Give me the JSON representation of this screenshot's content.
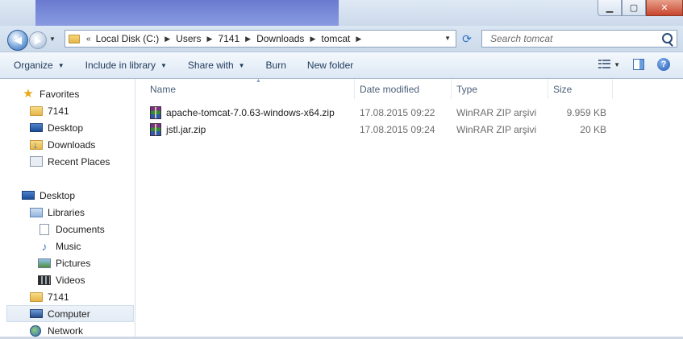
{
  "window": {
    "caption_buttons": [
      "minimize",
      "maximize",
      "close"
    ]
  },
  "address": {
    "prefix": "«",
    "crumbs": [
      "Local Disk (C:)",
      "Users",
      "7141",
      "Downloads",
      "tomcat"
    ],
    "search_placeholder": "Search tomcat"
  },
  "toolbar": {
    "organize": "Organize",
    "include_in_library": "Include in library",
    "share_with": "Share with",
    "burn": "Burn",
    "new_folder": "New folder"
  },
  "nav": {
    "items": [
      {
        "label": "Favorites",
        "icon": "star-icon"
      },
      {
        "label": "7141",
        "icon": "folder-icon"
      },
      {
        "label": "Desktop",
        "icon": "desktop-icon"
      },
      {
        "label": "Downloads",
        "icon": "downloads-icon"
      },
      {
        "label": "Recent Places",
        "icon": "recent-places-icon"
      },
      {
        "label": "Desktop",
        "icon": "desktop-icon"
      },
      {
        "label": "Libraries",
        "icon": "libraries-icon"
      },
      {
        "label": "Documents",
        "icon": "documents-icon"
      },
      {
        "label": "Music",
        "icon": "music-icon"
      },
      {
        "label": "Pictures",
        "icon": "pictures-icon"
      },
      {
        "label": "Videos",
        "icon": "videos-icon"
      },
      {
        "label": "7141",
        "icon": "folder-icon"
      },
      {
        "label": "Computer",
        "icon": "computer-icon"
      },
      {
        "label": "Network",
        "icon": "network-icon"
      }
    ],
    "selected": "Computer"
  },
  "columns": [
    "Name",
    "Date modified",
    "Type",
    "Size"
  ],
  "files": [
    {
      "name": "apache-tomcat-7.0.63-windows-x64.zip",
      "date": "17.08.2015 09:22",
      "type": "WinRAR ZIP arşivi",
      "size": "9.959 KB"
    },
    {
      "name": "jstl.jar.zip",
      "date": "17.08.2015 09:24",
      "type": "WinRAR ZIP arşivi",
      "size": "20 KB"
    }
  ],
  "colors": {
    "toolbar_text": "#1e395b",
    "selection": "#e3ebf5"
  }
}
